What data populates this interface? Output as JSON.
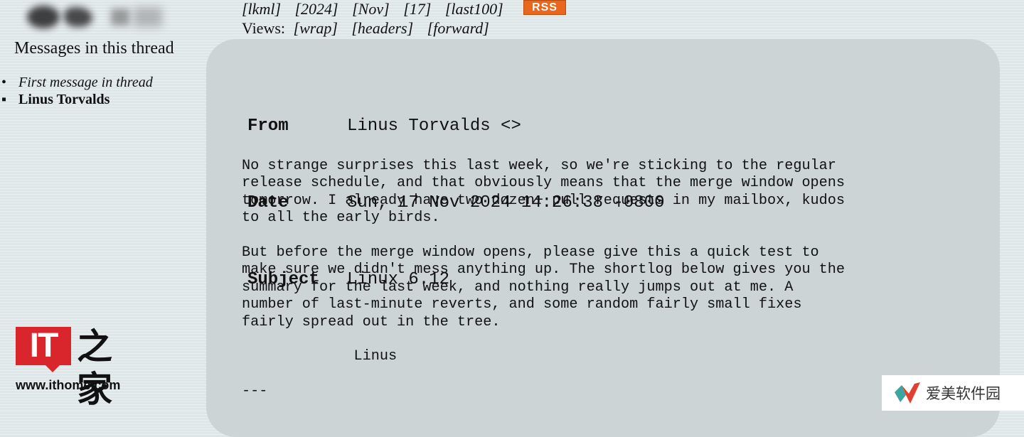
{
  "sidebar": {
    "thread_title": "Messages in this thread",
    "items": [
      {
        "bullet": "•",
        "label": "First message in thread"
      },
      {
        "bullet": "▪",
        "label": "Linus Torvalds"
      }
    ]
  },
  "nav": {
    "links": [
      "[lkml]",
      "[2024]",
      "[Nov]",
      "[17]",
      "[last100]"
    ],
    "rss": "RSS"
  },
  "views": {
    "label": "Views:",
    "links": [
      "[wrap]",
      "[headers]",
      "[forward]"
    ]
  },
  "message": {
    "headers": [
      {
        "key": "From",
        "value": "Linus Torvalds <>"
      },
      {
        "key": "Date",
        "value": "Sun, 17 Nov 2024 14:26:38 -0800"
      },
      {
        "key": "Subject",
        "value": "Linux 6.12"
      }
    ],
    "body": "No strange surprises this last week, so we're sticking to the regular\nrelease schedule, and that obviously means that the merge window opens\ntomorrow. I already have two dozen+ pull requests in my mailbox, kudos\nto all the early birds.\n\nBut before the merge window opens, please give this a quick test to\nmake sure we didn't mess anything up. The shortlog below gives you the\nsummary for the last week, and nothing really jumps out at me. A\nnumber of last-minute reverts, and some random fairly small fixes\nfairly spread out in the tree.\n\n             Linus\n\n---"
  },
  "watermarks": {
    "ithome_logo": "IT",
    "ithome_han": "之家",
    "ithome_url": "www.ithome.com",
    "aimei_text": "爱美软件园"
  },
  "colors": {
    "panel": "#ccd4d6",
    "background": "#dfe6e8",
    "rss": "#e8671c",
    "ithome_red": "#d9252c"
  }
}
